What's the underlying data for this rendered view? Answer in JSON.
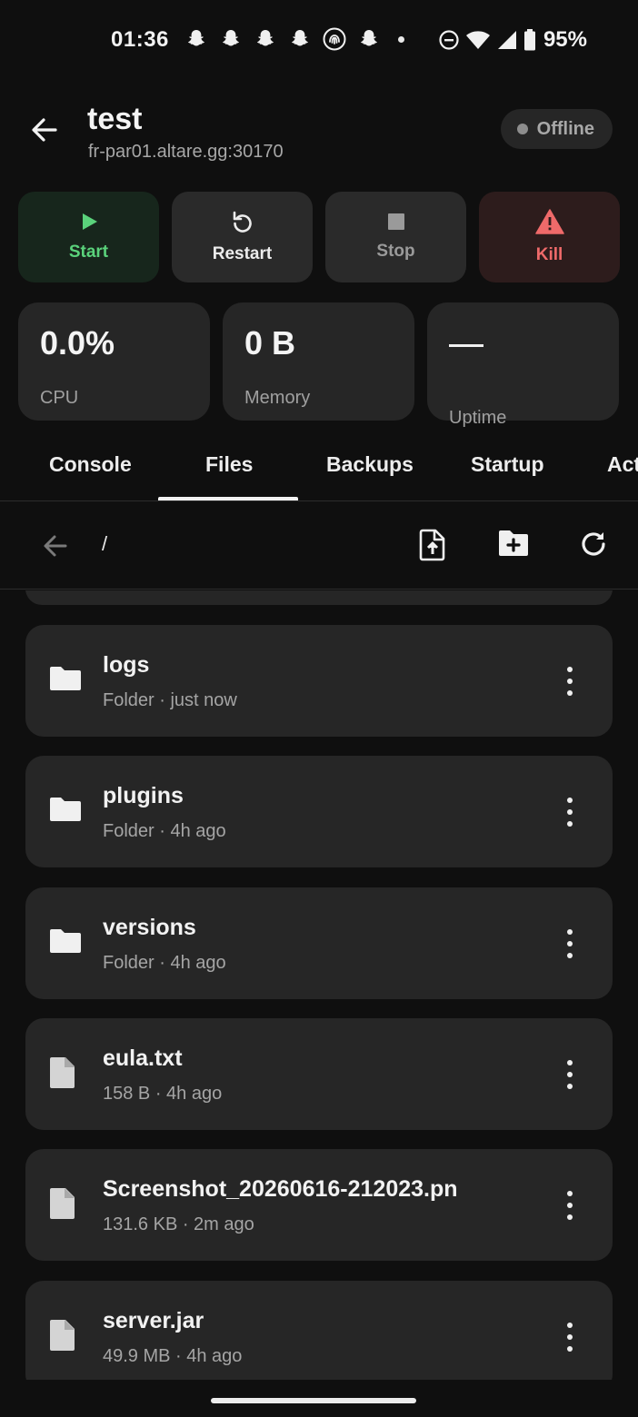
{
  "status_bar": {
    "time": "01:36",
    "notification_icons": [
      "snapchat-icon",
      "snapchat-icon",
      "snapchat-icon",
      "snapchat-icon",
      "fingerprint-icon",
      "snapchat-icon"
    ],
    "battery": "95%"
  },
  "header": {
    "server_name": "test",
    "server_address": "fr-par01.altare.gg:30170",
    "status": "Offline"
  },
  "power": {
    "start": "Start",
    "restart": "Restart",
    "stop": "Stop",
    "kill": "Kill"
  },
  "stats": {
    "cpu_value": "0.0%",
    "cpu_label": "CPU",
    "memory_value": "0 B",
    "memory_label": "Memory",
    "uptime_value": "—",
    "uptime_label": "Uptime"
  },
  "tabs": [
    "Console",
    "Files",
    "Backups",
    "Startup",
    "Act"
  ],
  "active_tab": "Files",
  "toolbar": {
    "path": "/"
  },
  "files": [
    {
      "name": "logs",
      "meta": "Folder · just now",
      "type": "folder"
    },
    {
      "name": "plugins",
      "meta": "Folder · 4h ago",
      "type": "folder"
    },
    {
      "name": "versions",
      "meta": "Folder · 4h ago",
      "type": "folder"
    },
    {
      "name": "eula.txt",
      "meta": "158 B · 4h ago",
      "type": "file"
    },
    {
      "name": "Screenshot_20260616-212023.pn",
      "meta": "131.6 KB · 2m ago",
      "type": "file"
    },
    {
      "name": "server.jar",
      "meta": "49.9 MB · 4h ago",
      "type": "file"
    }
  ],
  "colors": {
    "background": "#0f0f0f",
    "card": "#262626",
    "start_green": "#5ad27b",
    "kill_red": "#ef6a6a"
  }
}
